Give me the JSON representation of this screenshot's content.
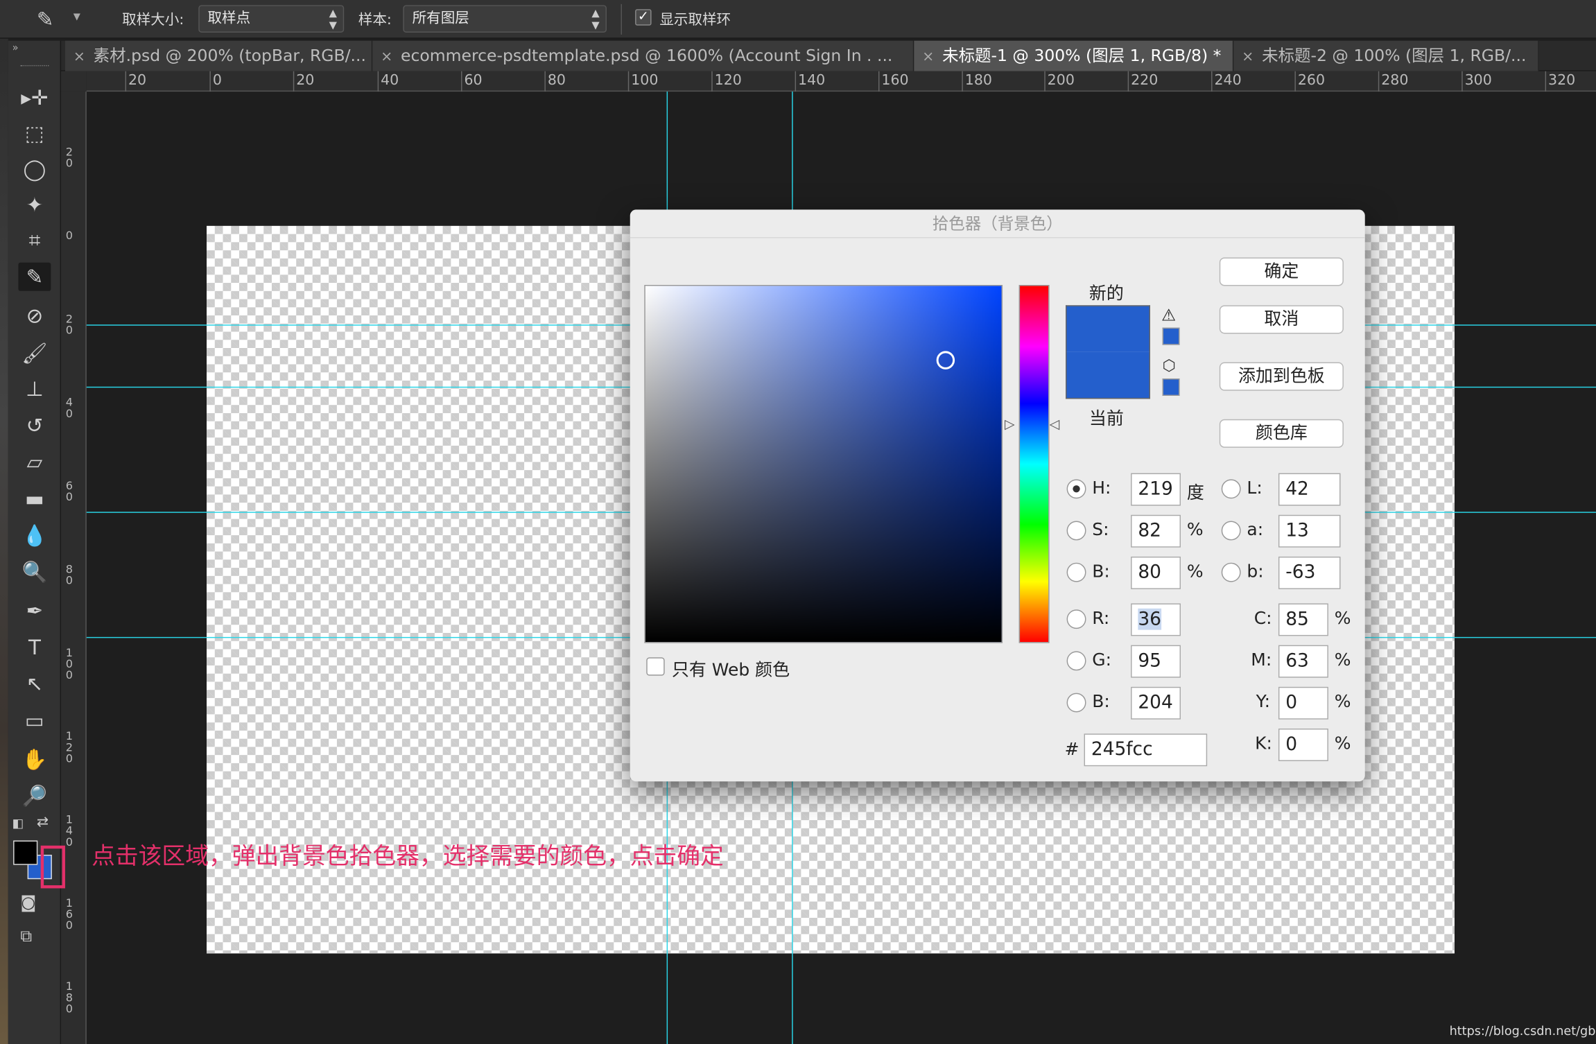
{
  "options_bar": {
    "sample_size_label": "取样大小:",
    "sample_size_value": "取样点",
    "sample_label": "样本:",
    "sample_value": "所有图层",
    "show_ring_label": "显示取样环",
    "show_ring_checked": true
  },
  "tabs": [
    {
      "label": "素材.psd @ 200% (topBar, RGB/...",
      "active": false
    },
    {
      "label": "ecommerce-psdtemplate.psd @ 1600% (Account Sign In   . ...",
      "active": false
    },
    {
      "label": "未标题-1 @ 300% (图层 1, RGB/8) *",
      "active": true
    },
    {
      "label": "未标题-2 @ 100% (图层 1, RGB/...",
      "active": false
    }
  ],
  "ruler": {
    "h_labels": [
      "20",
      "0",
      "20",
      "40",
      "60",
      "80",
      "100",
      "120",
      "140",
      "160",
      "180",
      "200",
      "220",
      "240",
      "260",
      "280",
      "300",
      "320"
    ],
    "v_labels": [
      "20",
      "0",
      "20",
      "40",
      "60",
      "80",
      "100",
      "120",
      "140",
      "160",
      "180"
    ]
  },
  "tools": [
    "move-tool",
    "marquee-tool",
    "lasso-tool",
    "magic-wand-tool",
    "crop-tool",
    "eyedropper-tool",
    "healing-brush-tool",
    "brush-tool",
    "clone-stamp-tool",
    "history-brush-tool",
    "eraser-tool",
    "gradient-tool",
    "blur-tool",
    "dodge-tool",
    "pen-tool",
    "type-tool",
    "path-selection-tool",
    "rectangle-tool",
    "hand-tool",
    "zoom-tool"
  ],
  "tool_glyphs": [
    "▸✛",
    "⬚",
    "◯",
    "✦",
    "⌗",
    "✎",
    "⊘",
    "🖌",
    "⊥",
    "↺",
    "▱",
    "▬",
    "💧",
    "🔍",
    "✒",
    "T",
    "↖",
    "▭",
    "✋",
    "🔎"
  ],
  "foreground_color": "#000000",
  "background_color": "#245fcc",
  "dialog": {
    "title": "拾色器（背景色）",
    "new_label": "新的",
    "current_label": "当前",
    "new_color": "#245fcc",
    "current_color": "#245fcc",
    "ok_button": "确定",
    "cancel_button": "取消",
    "add_swatch_button": "添加到色板",
    "color_library_button": "颜色库",
    "web_only_label": "只有 Web 颜色",
    "web_only_checked": false,
    "hsb": {
      "h_label": "H:",
      "h": "219",
      "h_unit": "度",
      "s_label": "S:",
      "s": "82",
      "s_unit": "%",
      "b_label": "B:",
      "b": "80",
      "b_unit": "%"
    },
    "lab": {
      "l_label": "L:",
      "l": "42",
      "a_label": "a:",
      "a": "13",
      "b_label": "b:",
      "b": "-63"
    },
    "rgb": {
      "r_label": "R:",
      "r": "36",
      "g_label": "G:",
      "g": "95",
      "b_label": "B:",
      "b": "204"
    },
    "cmyk": {
      "c_label": "C:",
      "c": "85",
      "m_label": "M:",
      "m": "63",
      "y_label": "Y:",
      "y": "0",
      "k_label": "K:",
      "k": "0",
      "unit": "%"
    },
    "hex_label": "#",
    "hex": "245fcc",
    "selected_mode": "H"
  },
  "annotation_text": "点击该区域，弹出背景色拾色器，选择需要的颜色，点击确定",
  "watermark": "https://blog.csdn.net/gbwine"
}
